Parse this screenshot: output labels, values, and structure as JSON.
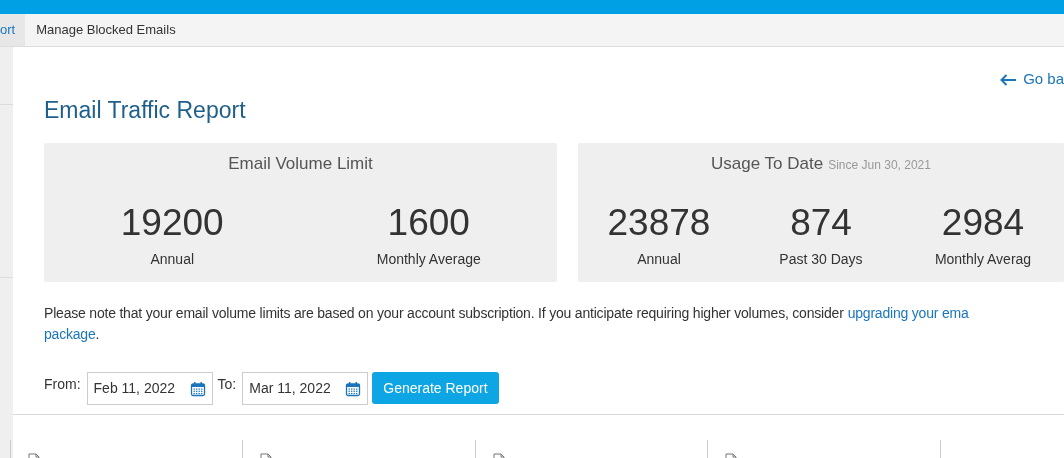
{
  "tabs": [
    {
      "label": "ort",
      "selected": true
    },
    {
      "label": "Manage Blocked Emails",
      "selected": false
    }
  ],
  "back_link": "Go ba",
  "title": "Email Traffic Report",
  "cards": [
    {
      "title": "Email Volume Limit",
      "stats": [
        {
          "value": "19200",
          "label": "Annual"
        },
        {
          "value": "1600",
          "label": "Monthly Average"
        }
      ]
    },
    {
      "title": "Usage To Date",
      "subtitle": "Since Jun 30, 2021",
      "stats": [
        {
          "value": "23878",
          "label": "Annual"
        },
        {
          "value": "874",
          "label": "Past 30 Days"
        },
        {
          "value": "2984",
          "label": "Monthly Averag"
        }
      ]
    }
  ],
  "note": {
    "text": "Please note that your email volume limits are based on your account subscription. If you anticipate requiring higher volumes, consider",
    "link_line1": "upgrading your ema",
    "link_line2": "package",
    "end": "."
  },
  "filters": {
    "from_label": "From:",
    "from_value": "Feb 11, 2022",
    "to_label": "To:",
    "to_value": "Mar 11, 2022",
    "button": "Generate Report"
  }
}
